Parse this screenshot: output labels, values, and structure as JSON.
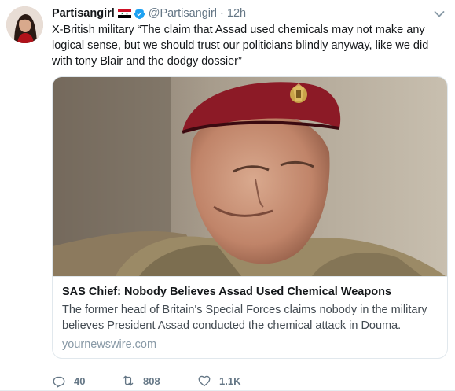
{
  "tweet": {
    "display_name": "Partisangirl",
    "handle": "@Partisangirl",
    "separator": "·",
    "time": "12h",
    "text": "X-British military “The claim that Assad used chemicals may not make any logical sense, but we should trust our politicians blindly anyway, like we did with tony Blair and the dodgy dossier”"
  },
  "card": {
    "title": "SAS Chief: Nobody Believes Assad Used Chemical Weapons",
    "description": "The former head of Britain's Special Forces claims nobody in the military believes President Assad conducted the chemical attack in Douma.",
    "domain": "yournewswire.com"
  },
  "actions": {
    "replies": "40",
    "retweets": "808",
    "likes": "1.1K"
  },
  "icons": {
    "avatar": "avatar-image",
    "flag": "syria-flag-icon",
    "verified": "verified-badge-icon",
    "caret": "chevron-down-icon",
    "reply": "reply-icon",
    "retweet": "retweet-icon",
    "like": "heart-icon"
  },
  "colors": {
    "verified": "#1da1f2",
    "secondary_text": "#657786",
    "domain_text": "#8899a6",
    "border": "#e1e8ed"
  }
}
